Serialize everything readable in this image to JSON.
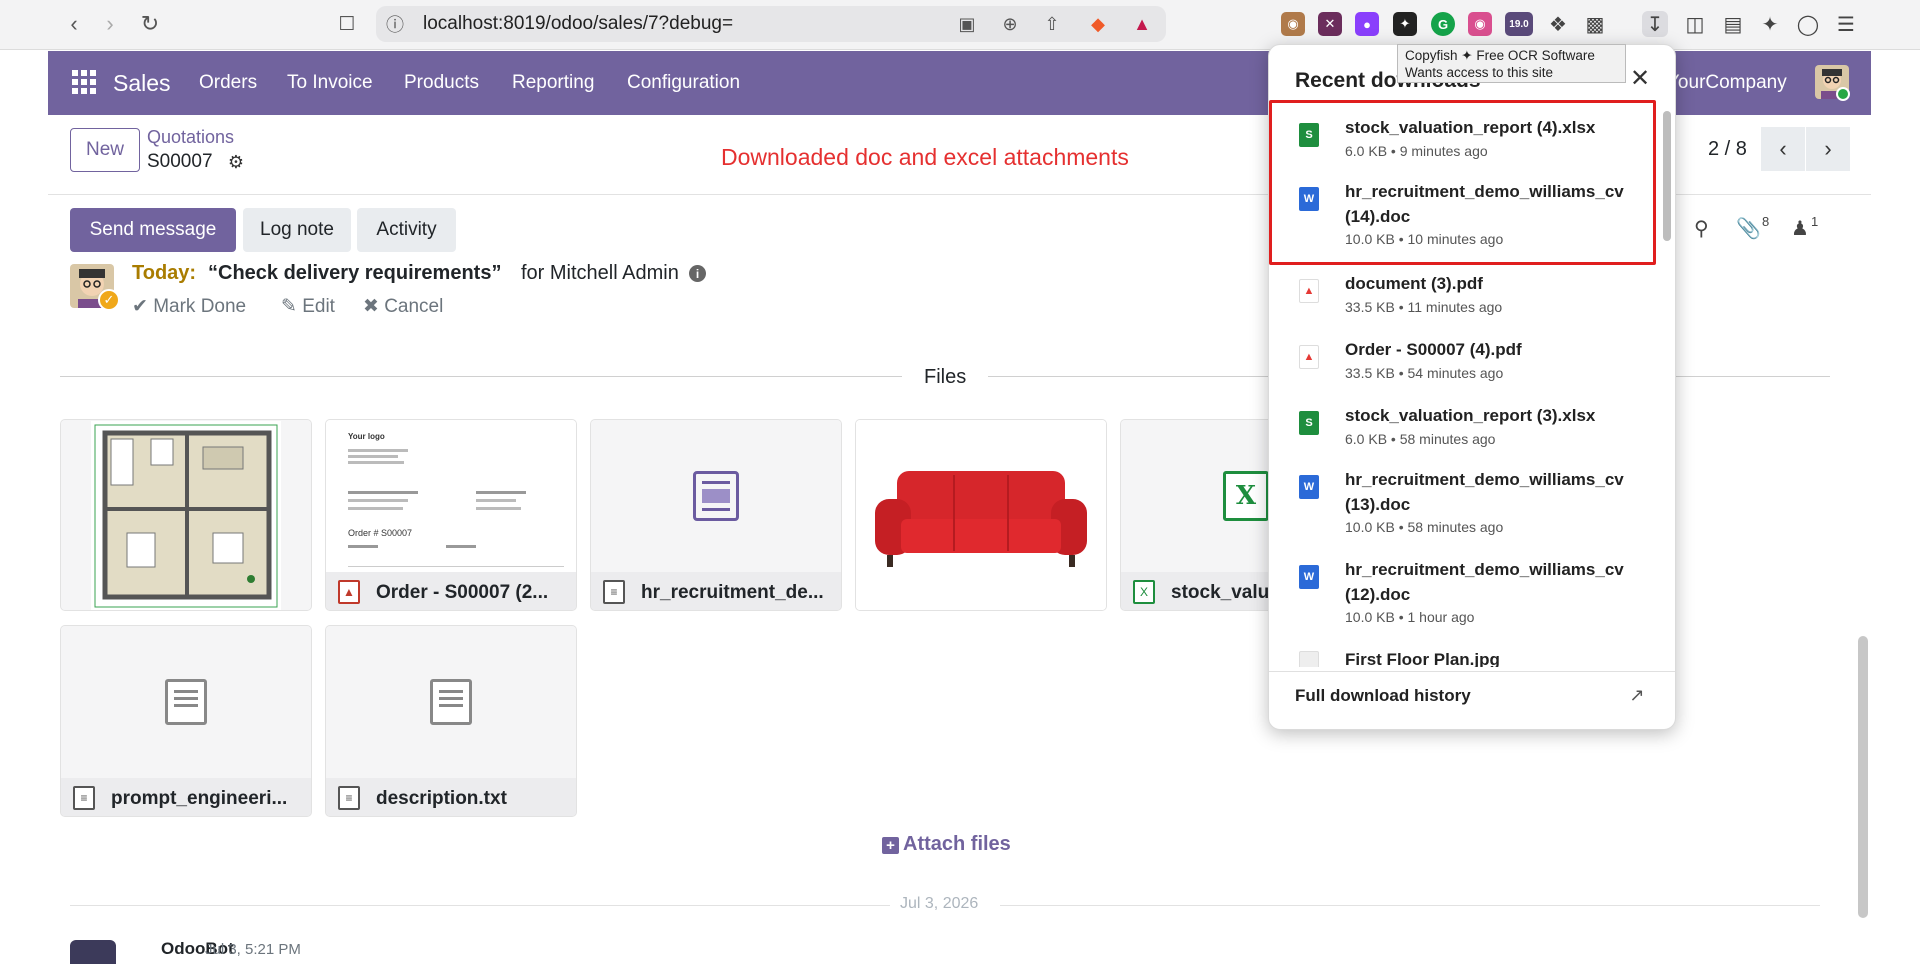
{
  "browser": {
    "url": "localhost:8019/odoo/sales/7?debug=",
    "extension_badge": "19.0"
  },
  "navbar": {
    "app_name": "Sales",
    "menu": [
      "Orders",
      "To Invoice",
      "Products",
      "Reporting",
      "Configuration"
    ],
    "company": "YourCompany"
  },
  "control_panel": {
    "new_label": "New",
    "breadcrumb": "Quotations",
    "record": "S00007",
    "pager": "2 / 8"
  },
  "annotation": "Downloaded doc and excel attachments",
  "chatter": {
    "send_message": "Send message",
    "log_note": "Log note",
    "activity": "Activity",
    "attachments_count": "8",
    "followers_count": "1"
  },
  "activity": {
    "today": "Today:",
    "summary": "“Check delivery requirements”",
    "for_user": "for Mitchell Admin",
    "mark_done": "Mark Done",
    "edit": "Edit",
    "cancel": "Cancel"
  },
  "files": {
    "title": "Files",
    "items": [
      {
        "name": "",
        "type": "image"
      },
      {
        "name": "Order - S00007 (2...",
        "type": "pdf"
      },
      {
        "name": "hr_recruitment_de...",
        "type": "doc"
      },
      {
        "name": "",
        "type": "image"
      },
      {
        "name": "stock_valu",
        "type": "xlsx"
      },
      {
        "name": "prompt_engineeri...",
        "type": "txt"
      },
      {
        "name": "description.txt",
        "type": "txt"
      }
    ],
    "attach_label": "Attach files"
  },
  "thread": {
    "date_separator": "Jul 3, 2026",
    "author": "OdooBot",
    "date": "Jul 3, 5:21 PM"
  },
  "downloads": {
    "title": "Recent downloads",
    "items": [
      {
        "name": "stock_valuation_report (4).xlsx",
        "meta": "6.0 KB • 9 minutes ago",
        "type": "xlsx"
      },
      {
        "name": "hr_recruitment_demo_williams_cv (14).doc",
        "meta": "10.0 KB • 10 minutes ago",
        "type": "doc"
      },
      {
        "name": "document (3).pdf",
        "meta": "33.5 KB • 11 minutes ago",
        "type": "pdf"
      },
      {
        "name": "Order - S00007 (4).pdf",
        "meta": "33.5 KB • 54 minutes ago",
        "type": "pdf"
      },
      {
        "name": "stock_valuation_report (3).xlsx",
        "meta": "6.0 KB • 58 minutes ago",
        "type": "xlsx"
      },
      {
        "name": "hr_recruitment_demo_williams_cv (13).doc",
        "meta": "10.0 KB • 58 minutes ago",
        "type": "doc"
      },
      {
        "name": "hr_recruitment_demo_williams_cv (12).doc",
        "meta": "10.0 KB • 1 hour ago",
        "type": "doc"
      },
      {
        "name": "First Floor Plan.jpg",
        "meta": "",
        "type": "jpg"
      }
    ],
    "footer": "Full download history"
  },
  "tooltip": {
    "line1_prefix": "Copyfish",
    "line1_suffix": "Free OCR Software",
    "line2": "Wants access to this site"
  },
  "colors": {
    "brand": "#71639e",
    "annotation": "#e53030",
    "highlight": "#e01e1e"
  }
}
